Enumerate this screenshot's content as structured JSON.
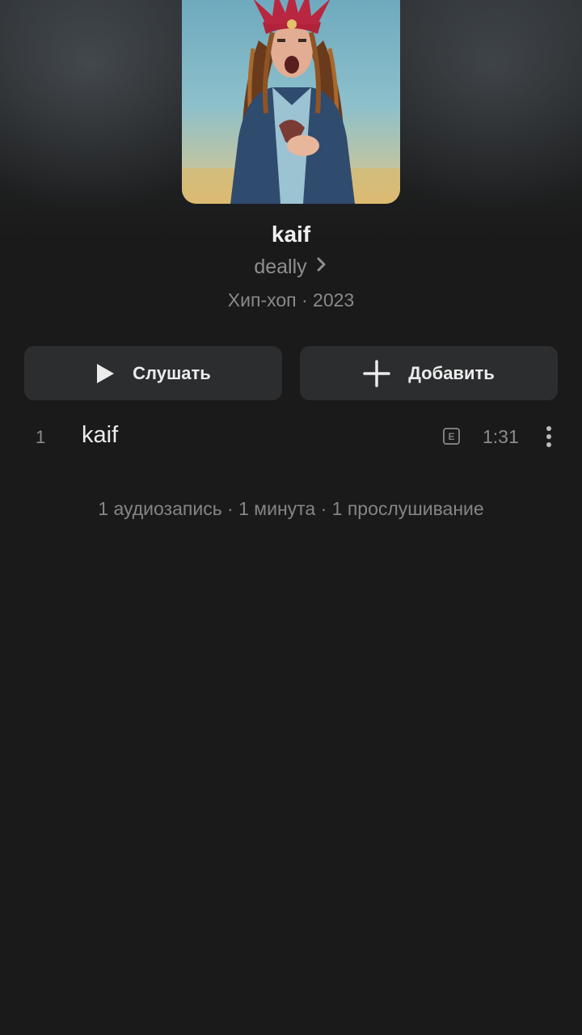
{
  "album": {
    "title": "kaif",
    "artist": "deally",
    "meta": "Хип-хоп · 2023"
  },
  "actions": {
    "play_label": "Слушать",
    "add_label": "Добавить"
  },
  "tracks": [
    {
      "number": "1",
      "title": "kaif",
      "explicit_badge": "E",
      "duration": "1:31"
    }
  ],
  "summary": "1 аудиозапись · 1 минута · 1 прослушивание",
  "icons": {
    "artist_chevron": "chevron-right-icon",
    "play": "play-icon",
    "add": "plus-icon",
    "explicit": "explicit-icon",
    "more": "more-vertical-icon"
  },
  "colors": {
    "background": "#1a1a1a",
    "button": "#2c2d2f",
    "primary_text": "#ececec",
    "secondary_text": "#8c8c8c"
  }
}
